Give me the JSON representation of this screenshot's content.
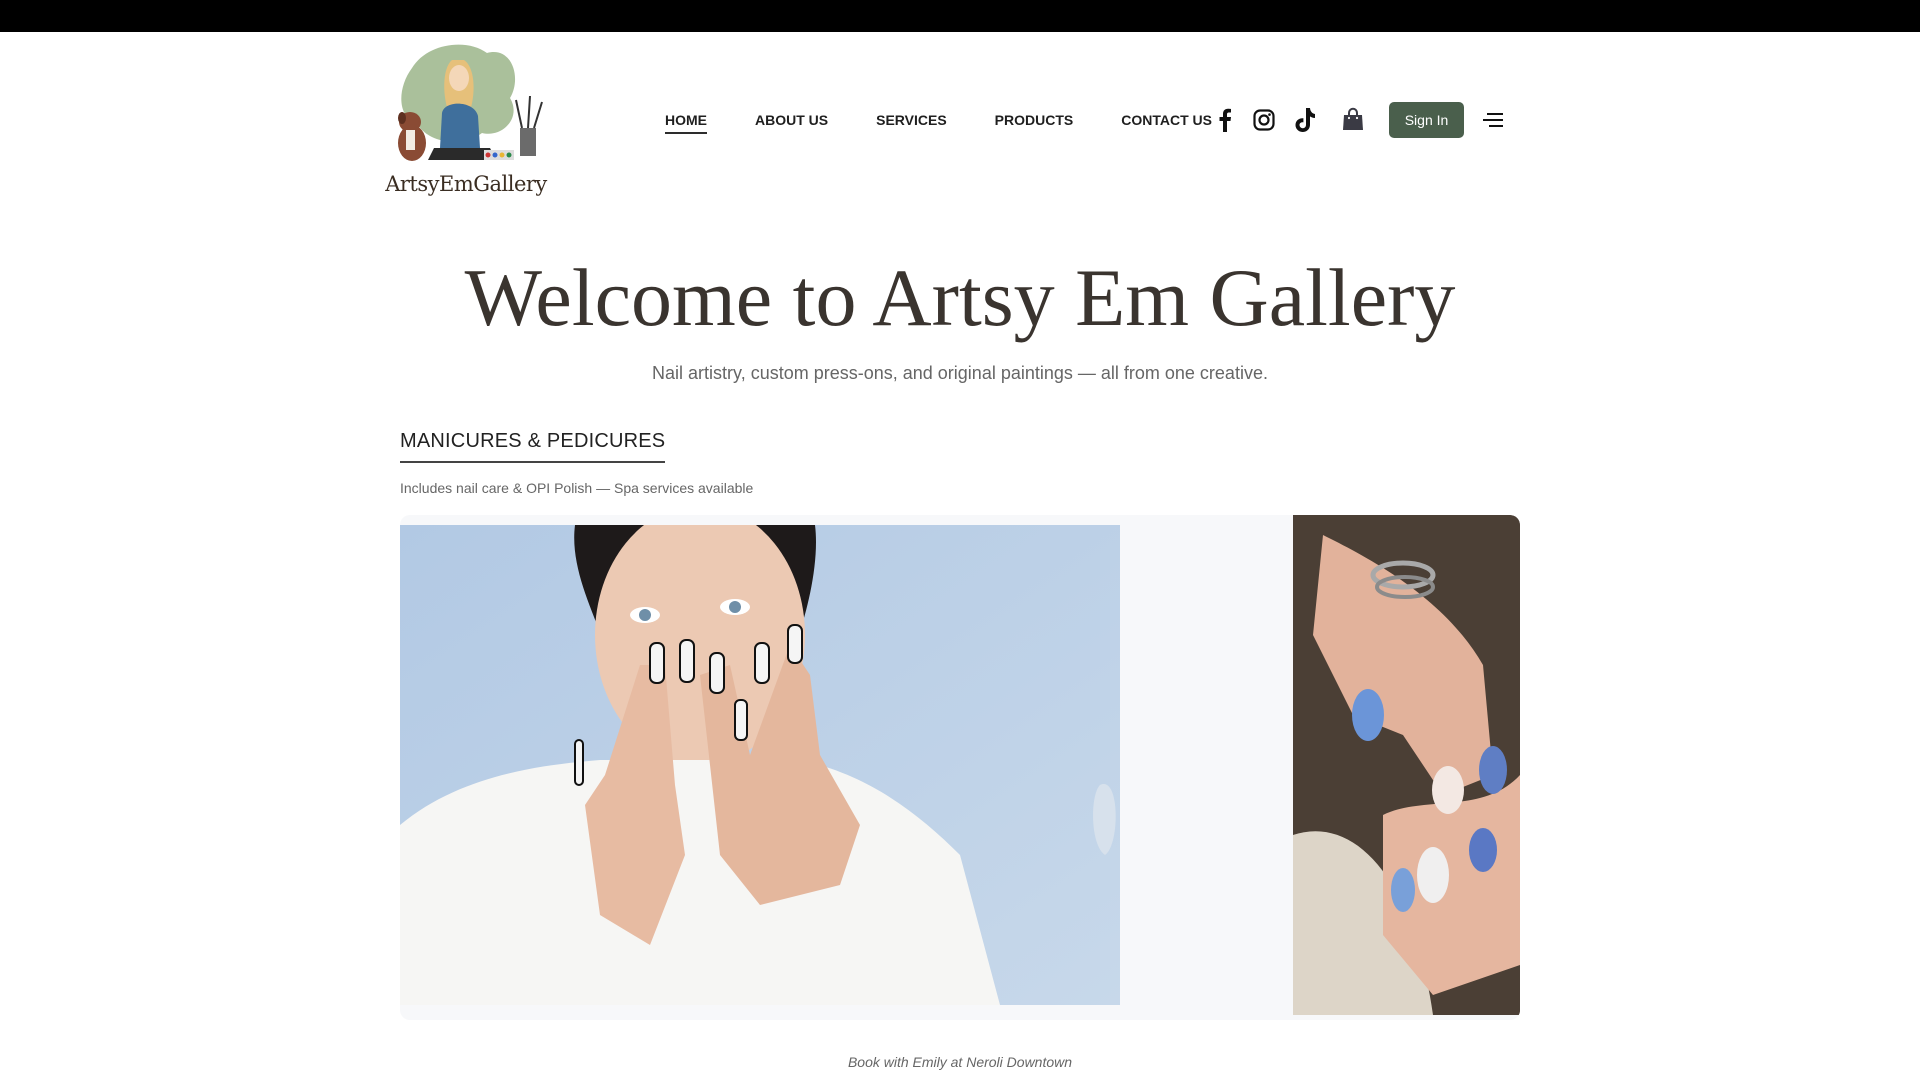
{
  "header": {
    "logo_text": "ArtsyEmGallery",
    "nav": [
      {
        "label": "HOME",
        "active": true
      },
      {
        "label": "ABOUT US",
        "active": false
      },
      {
        "label": "SERVICES",
        "active": false
      },
      {
        "label": "PRODUCTS",
        "active": false
      },
      {
        "label": "CONTACT US",
        "active": false
      }
    ],
    "social_icons": [
      "facebook-icon",
      "instagram-icon",
      "tiktok-icon"
    ],
    "cart_icon": "shopping-bag-icon",
    "signin_label": "Sign In",
    "menu_icon": "hamburger-menu-icon"
  },
  "hero": {
    "title": "Welcome to Artsy Em Gallery",
    "subtitle": "Nail artistry, custom press-ons, and original paintings — all from one creative."
  },
  "section": {
    "title": "MANICURES & PEDICURES",
    "note": "Includes nail care & OPI Polish — Spa services available"
  },
  "caption": "Book with Emily at Neroli Downtown",
  "colors": {
    "accent_button": "#4a5f4c",
    "top_bar": "#000000",
    "title_text": "#3a342f"
  }
}
